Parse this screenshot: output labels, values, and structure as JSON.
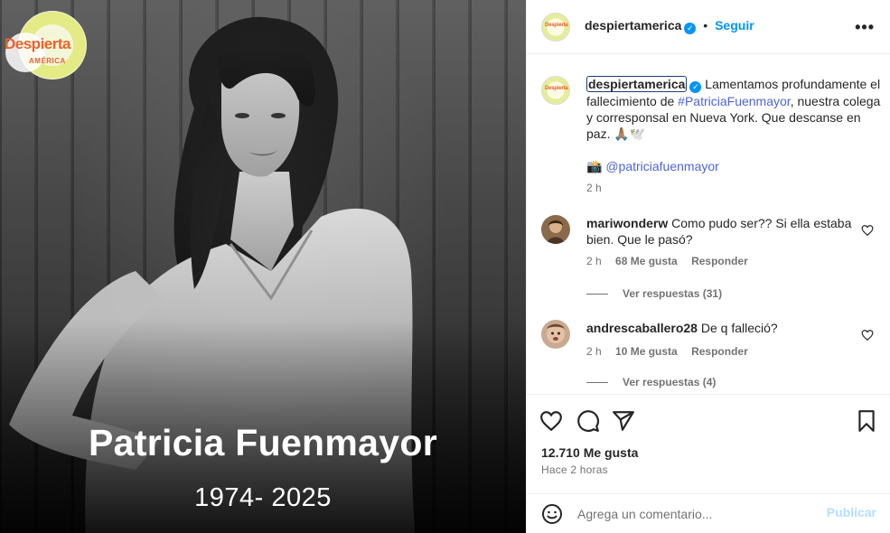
{
  "image": {
    "name": "Patricia Fuenmayor",
    "years": "1974- 2025",
    "logo_main": "Despierta",
    "logo_sub": "AMÉRICA"
  },
  "header": {
    "username": "despiertamerica",
    "separator": "•",
    "follow_label": "Seguir",
    "more_icon": "more-horizontal-icon",
    "avatar_label": "Despierta"
  },
  "caption": {
    "username": "despiertamerica",
    "text_1": "Lamentamos profundamente el fallecimiento de ",
    "hashtag": "#PatriciaFuenmayor",
    "text_2": ", nuestra colega y corresponsal en Nueva York. Que descanse en paz. 🙏🏽🕊️",
    "camera_emoji": "📸",
    "credit": "@patriciafuenmayor",
    "time": "2 h"
  },
  "comments": [
    {
      "username": "mariwonderw",
      "text": "Como pudo ser?? Si ella estaba bien. Que le pasó?",
      "time": "2 h",
      "likes": "68 Me gusta",
      "reply_label": "Responder",
      "replies": "Ver respuestas (31)"
    },
    {
      "username": "andrescaballero28",
      "text": "De q falleció?",
      "time": "2 h",
      "likes": "10 Me gusta",
      "reply_label": "Responder",
      "replies": "Ver respuestas (4)"
    }
  ],
  "actions": {
    "icons": [
      "heart-icon",
      "comment-icon",
      "share-icon",
      "bookmark-icon"
    ],
    "likes": "12.710 Me gusta",
    "posted": "Hace 2 horas"
  },
  "add_comment": {
    "placeholder": "Agrega un comentario...",
    "post_label": "Publicar"
  },
  "colors": {
    "accent": "#0095f6",
    "link": "#4f65d4",
    "muted": "#737373",
    "brand": "#e8632a"
  }
}
